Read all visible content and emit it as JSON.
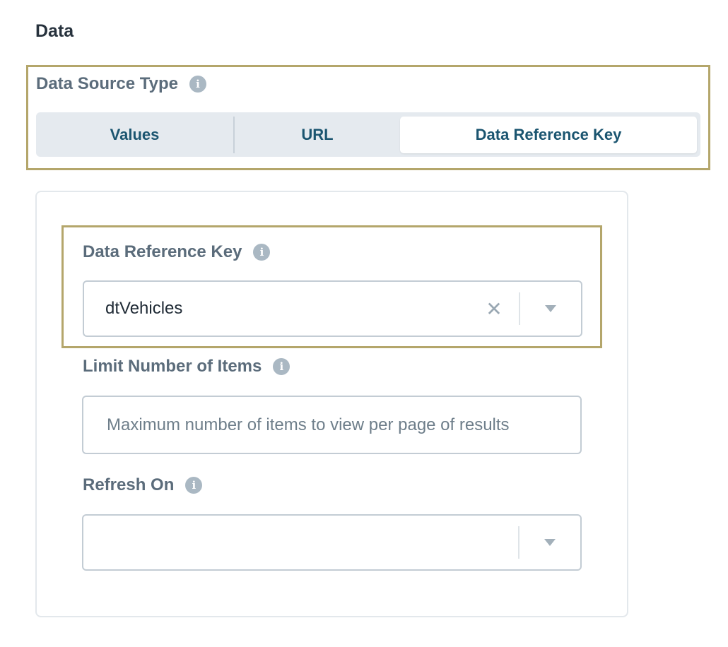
{
  "section_title": "Data",
  "data_source_type": {
    "label": "Data Source Type",
    "options": [
      "Values",
      "URL",
      "Data Reference Key"
    ],
    "selected": "Data Reference Key"
  },
  "data_reference_key": {
    "label": "Data Reference Key",
    "value": "dtVehicles",
    "clear_symbol": "✕"
  },
  "limit_items": {
    "label": "Limit Number of Items",
    "placeholder": "Maximum number of items to view per page of results"
  },
  "refresh_on": {
    "label": "Refresh On",
    "value": ""
  },
  "icons": {
    "info": "i",
    "info_icon_name": "info-icon",
    "clear_icon_name": "close-icon",
    "dropdown_icon_name": "chevron-down-icon"
  },
  "colors": {
    "highlight_border": "#b4a66b",
    "segment_text": "#1b5570",
    "label_text": "#5b6c7b"
  }
}
